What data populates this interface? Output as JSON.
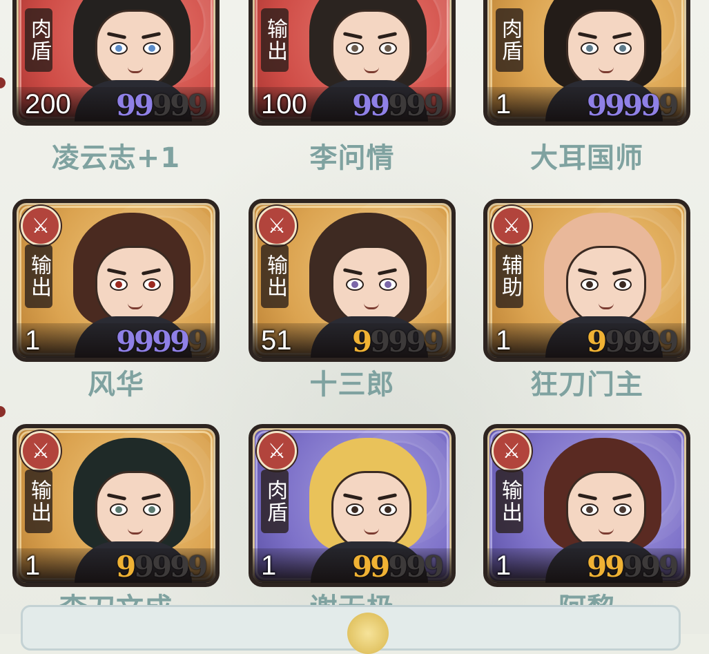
{
  "heroes": [
    {
      "name": "凌云志+1",
      "role": "肉盾",
      "level": "200",
      "frame": "red",
      "stars_on": 2,
      "star_color": "purple",
      "hair": "#24211f",
      "iris": "#5b8cc8"
    },
    {
      "name": "李问情",
      "role": "输出",
      "level": "100",
      "frame": "red",
      "stars_on": 2,
      "star_color": "purple",
      "hair": "#2b2420",
      "iris": "#6b5a4c"
    },
    {
      "name": "大耳国师",
      "role": "肉盾",
      "level": "1",
      "frame": "gold",
      "stars_on": 4,
      "star_color": "purple",
      "hair": "#231c18",
      "iris": "#5d7a8a"
    },
    {
      "name": "风华",
      "role": "输出",
      "level": "1",
      "frame": "gold",
      "stars_on": 4,
      "star_color": "purple",
      "hair": "#4a2a20",
      "iris": "#9b2a20"
    },
    {
      "name": "十三郎",
      "role": "输出",
      "level": "51",
      "frame": "gold",
      "stars_on": 1,
      "star_color": "gold",
      "hair": "#3e2a22",
      "iris": "#7a67a8"
    },
    {
      "name": "狂刀门主",
      "role": "辅助",
      "level": "1",
      "frame": "gold",
      "stars_on": 1,
      "star_color": "gold",
      "hair": "#e9b89a",
      "iris": "#3a2a22"
    },
    {
      "name": "李刀文成",
      "role": "输出",
      "level": "1",
      "frame": "gold",
      "stars_on": 1,
      "star_color": "gold",
      "hair": "#1f2a28",
      "iris": "#5c7a70"
    },
    {
      "name": "谢无极",
      "role": "肉盾",
      "level": "1",
      "frame": "purple",
      "stars_on": 2,
      "star_color": "gold",
      "hair": "#e9c25a",
      "iris": "#3a2a22"
    },
    {
      "name": "阿黎",
      "role": "输出",
      "level": "1",
      "frame": "purple",
      "stars_on": 2,
      "star_color": "gold",
      "hair": "#5a2a22",
      "iris": "#4a3a33"
    }
  ],
  "star_glyph": "9",
  "weapon_icon": "sword-badge-icon",
  "colors": {
    "name_text": "#7fa2a0",
    "star_purple": "#8f80e6",
    "star_gold": "#f0b234",
    "star_off": "#3d3a3a"
  }
}
